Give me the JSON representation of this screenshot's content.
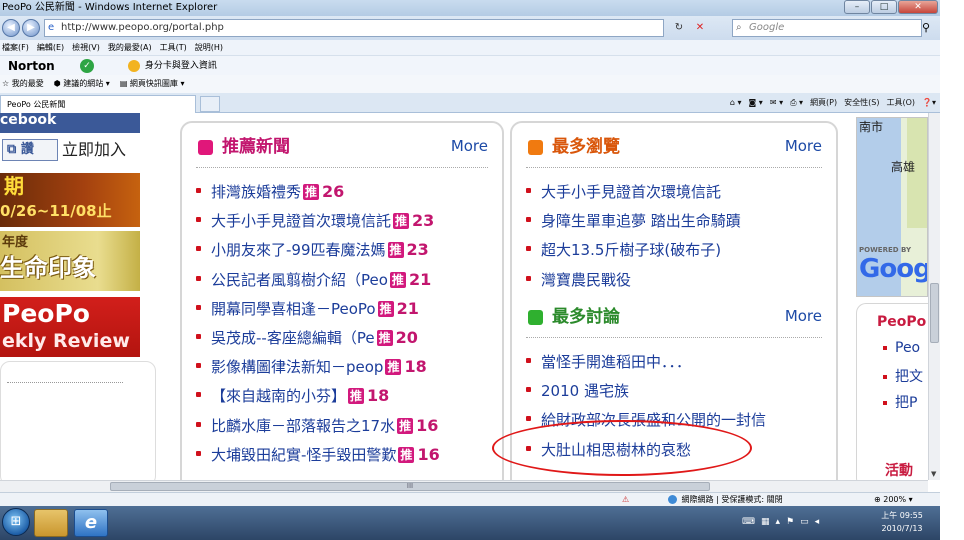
{
  "window": {
    "title": "PeoPo 公民新聞 - Windows Internet Explorer",
    "controls": {
      "minimize": "–",
      "maximize": "□",
      "close": "✕"
    }
  },
  "address": {
    "url": "http://www.peopo.org/portal.php",
    "search_placeholder": "Google",
    "back": "◀",
    "forward": "▶",
    "refresh": "↻",
    "stop": "✕",
    "search_go": "⚲"
  },
  "menu": [
    "檔案(F)",
    "編輯(E)",
    "檢視(V)",
    "我的最愛(A)",
    "工具(T)",
    "說明(H)"
  ],
  "norton": {
    "label": "Norton",
    "check": "✓",
    "id_label": "身分卡與登入資訊"
  },
  "favorites": {
    "favorites_label": "我的最愛",
    "suggested": "建議的網站",
    "gallery": "網頁快訊圖庫"
  },
  "tabs": {
    "active_label": "PeoPo 公民新聞"
  },
  "commandbar": [
    "網頁(P)",
    "安全性(S)",
    "工具(O)"
  ],
  "left": {
    "facebook": "cebook",
    "join_icon": "讚",
    "join_text": "立即加入",
    "event_line1": "期",
    "event_line2": "0/26~11/08止",
    "life_line1": "年度",
    "life_line2": "生命印象",
    "weekly_line1": "PeoPo",
    "weekly_line2": "ekly Review"
  },
  "recommended": {
    "title": "推薦新聞",
    "more": "More",
    "badge": "推",
    "items": [
      {
        "title": "排灣族婚禮秀",
        "count": "26"
      },
      {
        "title": "大手小手見證首次環境信託",
        "count": "23"
      },
      {
        "title": "小朋友來了-99匹春魔法媽",
        "count": "23"
      },
      {
        "title": "公民記者風翦樹介紹（Peo",
        "count": "21"
      },
      {
        "title": "開幕同學喜相逢－PeoPo",
        "count": "21"
      },
      {
        "title": "吳茂成--客座總編輯（Pe",
        "count": "20"
      },
      {
        "title": "影像構圖律法新知－peop",
        "count": "18"
      },
      {
        "title": "【來自越南的小芬】",
        "count": "18"
      },
      {
        "title": "比麟水庫－部落報告之17水",
        "count": "16"
      },
      {
        "title": "大埔毀田紀實-怪手毀田警歎",
        "count": "16"
      }
    ]
  },
  "most_viewed": {
    "title": "最多瀏覽",
    "more": "More",
    "items": [
      "大手小手見證首次環境信託",
      "身障生單車追夢 踏出生命騎蹟",
      "超大13.5斤樹子球(破布子)",
      "灣寶農民戰役"
    ]
  },
  "most_discussed": {
    "title": "最多討論",
    "more": "More",
    "items": [
      "當怪手開進稻田中．．．",
      "2010 遇宅族",
      "給財政部次長張盛和公開的一封信",
      "大肚山相思樹林的哀愁"
    ]
  },
  "map": {
    "city1": "南市",
    "city2": "高雄",
    "powered": "POWERED BY",
    "google": "Goog"
  },
  "right_box": {
    "title": "PeoPo",
    "items": [
      "Peo",
      "把文",
      "把P"
    ],
    "bottom": "活動"
  },
  "status": {
    "zone": "網際網路 | 受保護模式: 關閉",
    "zoom": "200%",
    "hscroll_grip": "III"
  },
  "taskbar": {
    "start": "⊞",
    "ie": "e",
    "clock_time": "上午 09:55",
    "clock_date": "2010/7/13"
  },
  "colors": {
    "recommended_square": "#e0177a",
    "most_viewed_square": "#f07a10",
    "most_discussed_square": "#2fb02f",
    "recommended_title": "#c2166e",
    "most_viewed_title": "#d9560a",
    "most_discussed_title": "#2b8a2b",
    "annotation": "#e01818"
  }
}
